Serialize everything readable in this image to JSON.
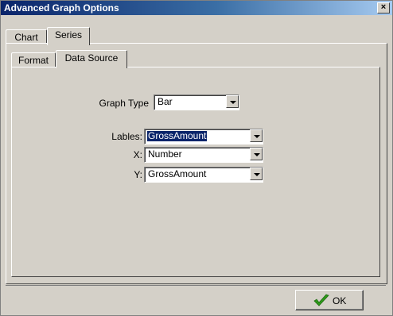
{
  "window": {
    "title": "Advanced Graph Options",
    "close_symbol": "×"
  },
  "outer_tabs": [
    {
      "label": "Chart",
      "active": false
    },
    {
      "label": "Series",
      "active": true
    }
  ],
  "inner_tabs": [
    {
      "label": "Format",
      "active": false
    },
    {
      "label": "Data Source",
      "active": true
    }
  ],
  "form": {
    "graph_type_label": "Graph Type",
    "graph_type_value": "Bar",
    "labels_label": "Lables:",
    "labels_value": "GrossAmount",
    "x_label": "X:",
    "x_value": "Number",
    "y_label": "Y:",
    "y_value": "GrossAmount"
  },
  "footer": {
    "ok_label": "OK"
  },
  "icons": {
    "ok_icon": "checkmark-icon",
    "close_icon": "close-icon",
    "dropdown_icon": "chevron-down-icon"
  },
  "colors": {
    "title_bar": "#0a246a",
    "face": "#d4d0c8",
    "selection": "#0a246a",
    "checkmark": "#2e9a1a"
  }
}
